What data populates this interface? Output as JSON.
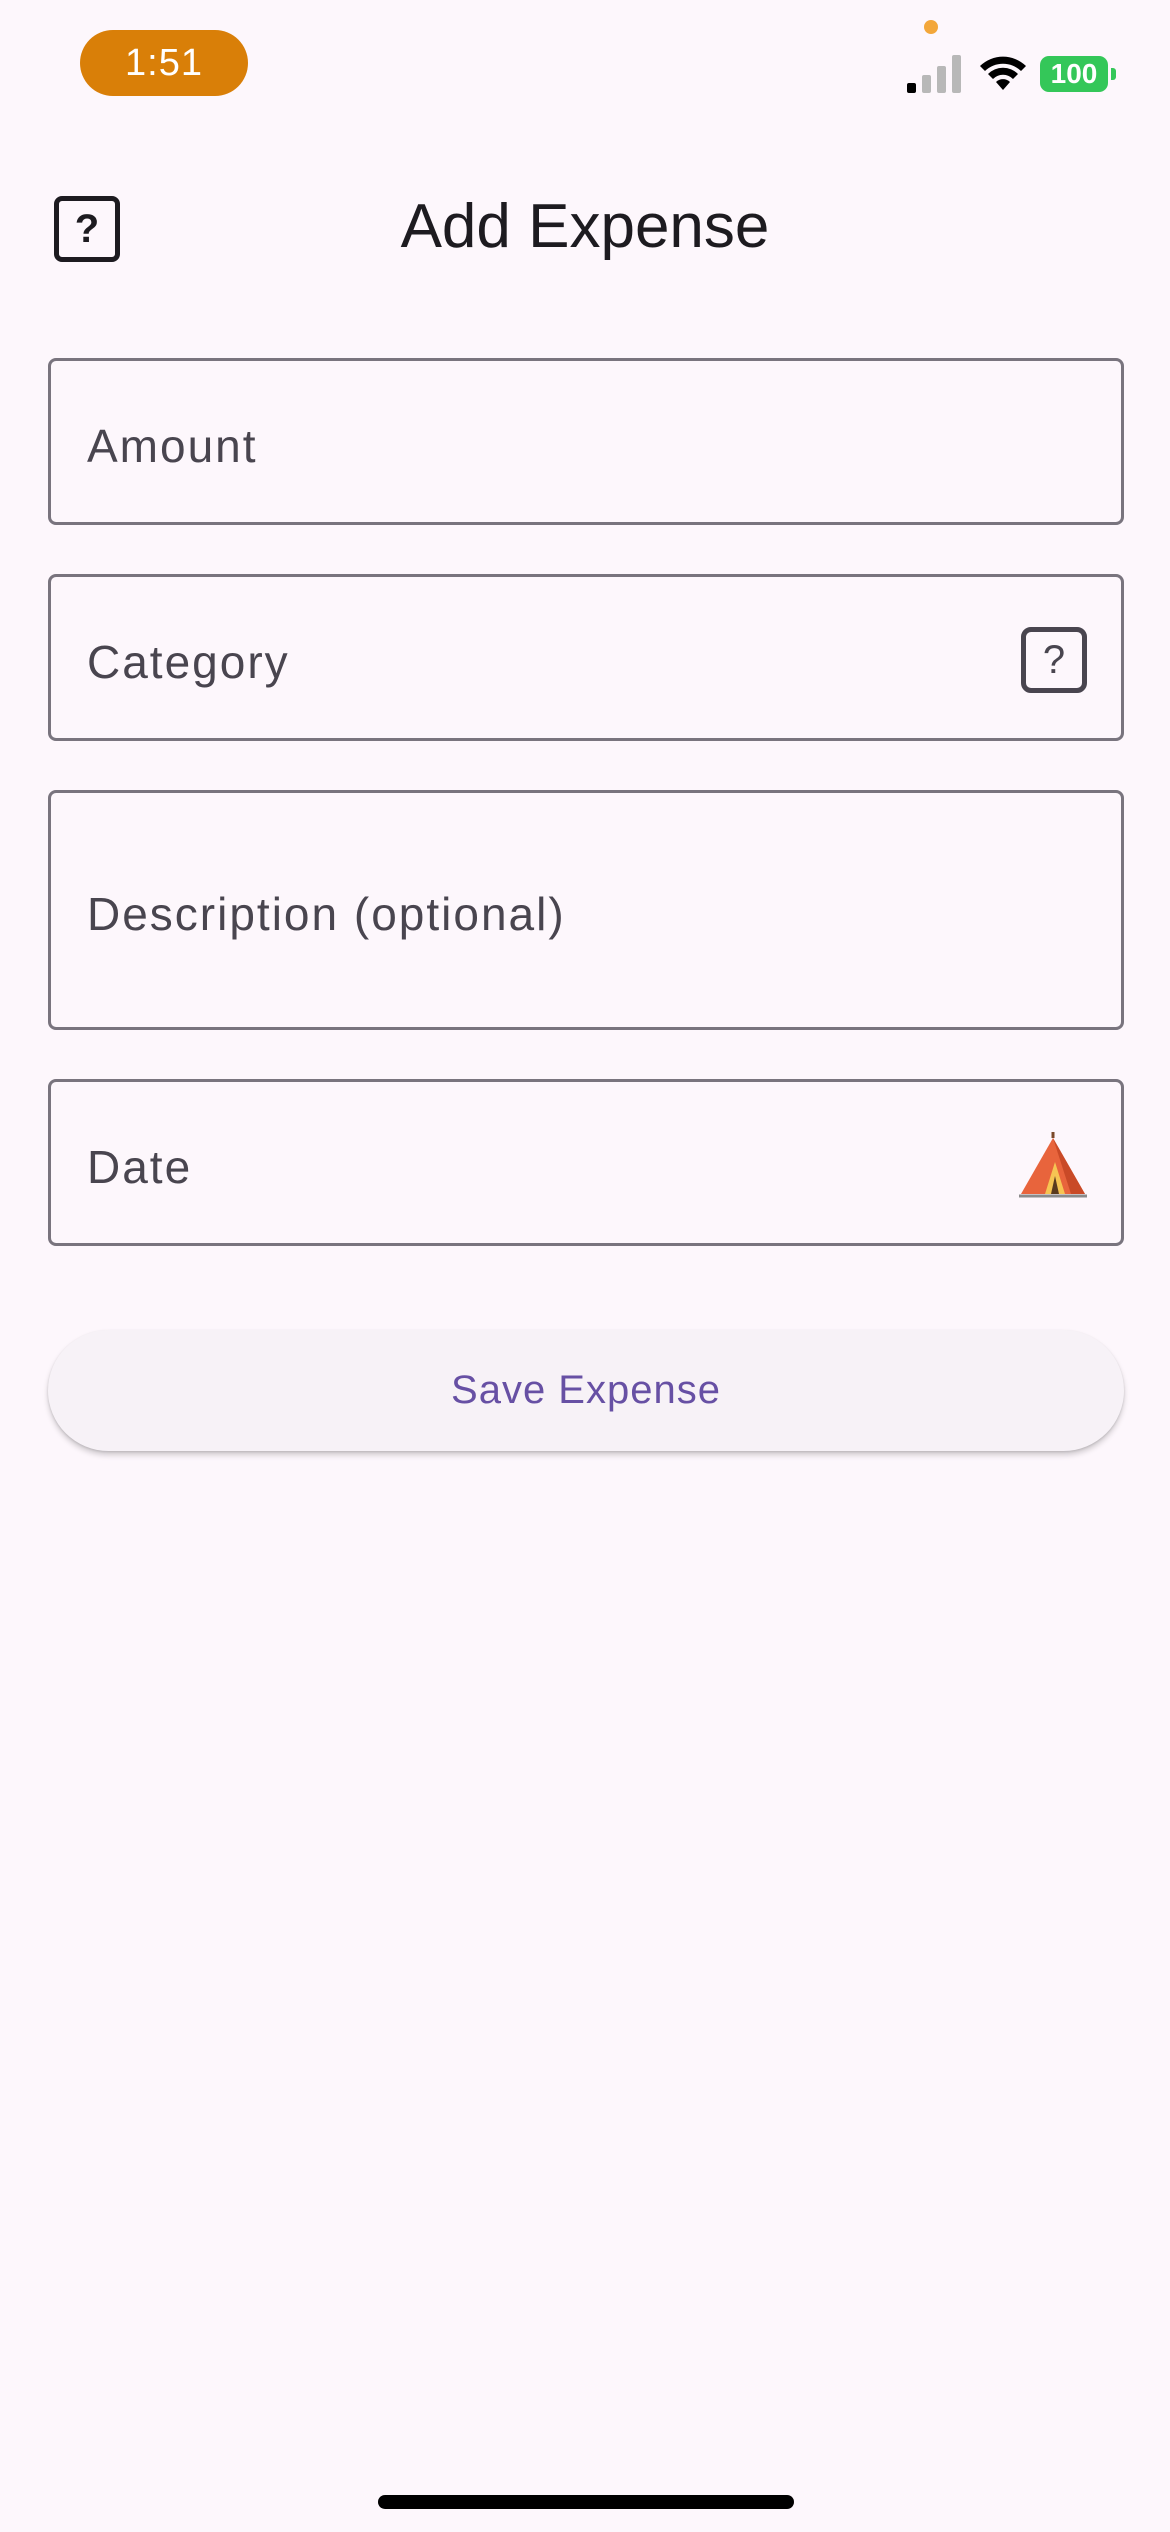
{
  "status_bar": {
    "time": "1:51",
    "battery": "100"
  },
  "app_bar": {
    "title": "Add Expense",
    "leading_icon": "help-square-icon",
    "leading_icon_glyph": "?"
  },
  "form": {
    "amount_label": "Amount",
    "category_label": "Category",
    "category_icon": "help-square-icon",
    "category_icon_glyph": "?",
    "description_label": "Description (optional)",
    "date_label": "Date",
    "date_icon": "tent-icon"
  },
  "actions": {
    "save_label": "Save Expense"
  },
  "colors": {
    "background": "#fdf7fc",
    "primary": "#6750a4",
    "time_pill": "#d97f08",
    "battery": "#34c759",
    "outline": "#79747e"
  }
}
